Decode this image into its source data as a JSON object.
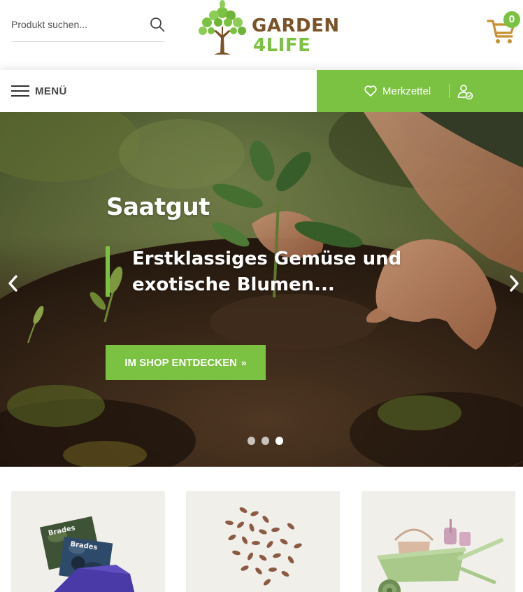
{
  "header": {
    "search": {
      "placeholder": "Produkt suchen...",
      "value": ""
    },
    "logo": {
      "line1": "GARDEN",
      "line2": "4LIFE"
    },
    "cart": {
      "count": "0"
    }
  },
  "nav": {
    "menu_label": "MENÜ",
    "wishlist_label": "Merkzettel"
  },
  "hero": {
    "title": "Saatgut",
    "subtitle": "Erstklassiges Gemüse und exotische Blumen...",
    "cta_label": "IM SHOP ENTDECKEN",
    "cta_icon": "»",
    "slides": 3,
    "active_slide": 3
  },
  "colors": {
    "brand_green": "#7cc242",
    "brand_brown": "#7b5127",
    "cart_gold": "#c8902f",
    "tile_bg": "#f1efea"
  },
  "icons": [
    "search-icon",
    "cart-icon",
    "hamburger-icon",
    "heart-icon",
    "account-icon",
    "chevron-left-icon",
    "chevron-right-icon"
  ]
}
